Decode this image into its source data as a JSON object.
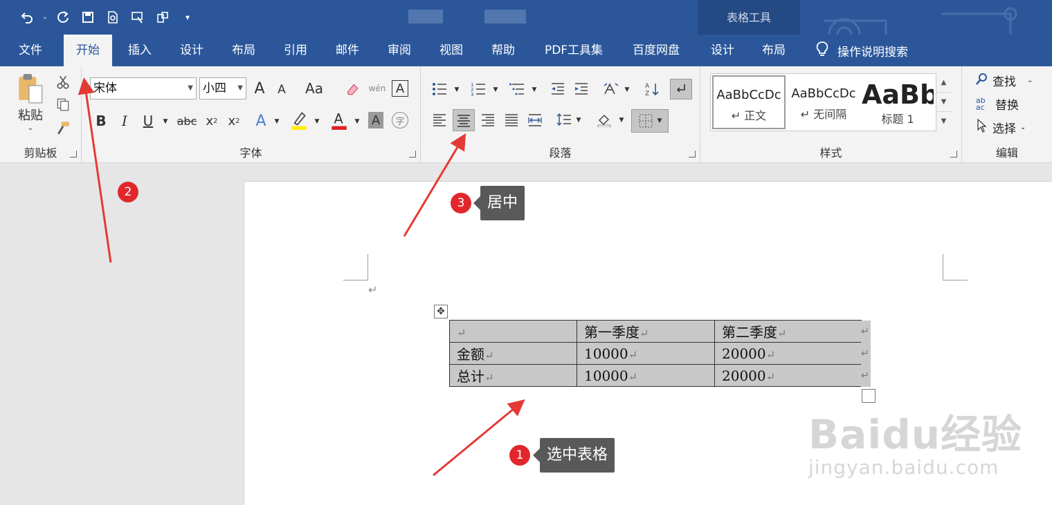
{
  "titlebar": {
    "context_label": "表格工具"
  },
  "tabs": [
    {
      "label": "文件"
    },
    {
      "label": "开始"
    },
    {
      "label": "插入"
    },
    {
      "label": "设计"
    },
    {
      "label": "布局"
    },
    {
      "label": "引用"
    },
    {
      "label": "邮件"
    },
    {
      "label": "审阅"
    },
    {
      "label": "视图"
    },
    {
      "label": "帮助"
    },
    {
      "label": "PDF工具集"
    },
    {
      "label": "百度网盘"
    },
    {
      "label": "设计"
    },
    {
      "label": "布局"
    }
  ],
  "tell_me": "操作说明搜索",
  "clipboard": {
    "paste": "粘贴",
    "group": "剪贴板"
  },
  "font": {
    "name": "宋体",
    "size": "小四",
    "group": "字体",
    "grow": "A",
    "shrink": "A",
    "case": "Aa",
    "phonetic": "wén",
    "bold": "B",
    "italic": "I",
    "underline": "U",
    "strike": "abc",
    "sub": "x",
    "sup": "x",
    "color_a": "A"
  },
  "paragraph": {
    "group": "段落"
  },
  "styles": {
    "group": "样式",
    "items": [
      {
        "preview": "AaBbCcDc",
        "name": "↵ 正文"
      },
      {
        "preview": "AaBbCcDc",
        "name": "↵ 无间隔"
      },
      {
        "preview": "AaBb",
        "name": "标题 1"
      }
    ]
  },
  "editing": {
    "group": "编辑",
    "find": "查找",
    "replace": "替换",
    "select": "选择"
  },
  "document": {
    "table": {
      "rows": [
        [
          "",
          "第一季度",
          "第二季度"
        ],
        [
          "金额",
          "10000",
          "20000"
        ],
        [
          "总计",
          "10000",
          "20000"
        ]
      ]
    }
  },
  "annotations": {
    "step1": {
      "num": "1",
      "text": "选中表格"
    },
    "step2": {
      "num": "2"
    },
    "step3": {
      "num": "3",
      "text": "居中"
    }
  },
  "watermark": {
    "line1": "Baidu经验",
    "line2": "jingyan.baidu.com"
  },
  "colors": {
    "accent": "#2b579a",
    "badge": "#e0282c",
    "arrow": "#e53935"
  }
}
